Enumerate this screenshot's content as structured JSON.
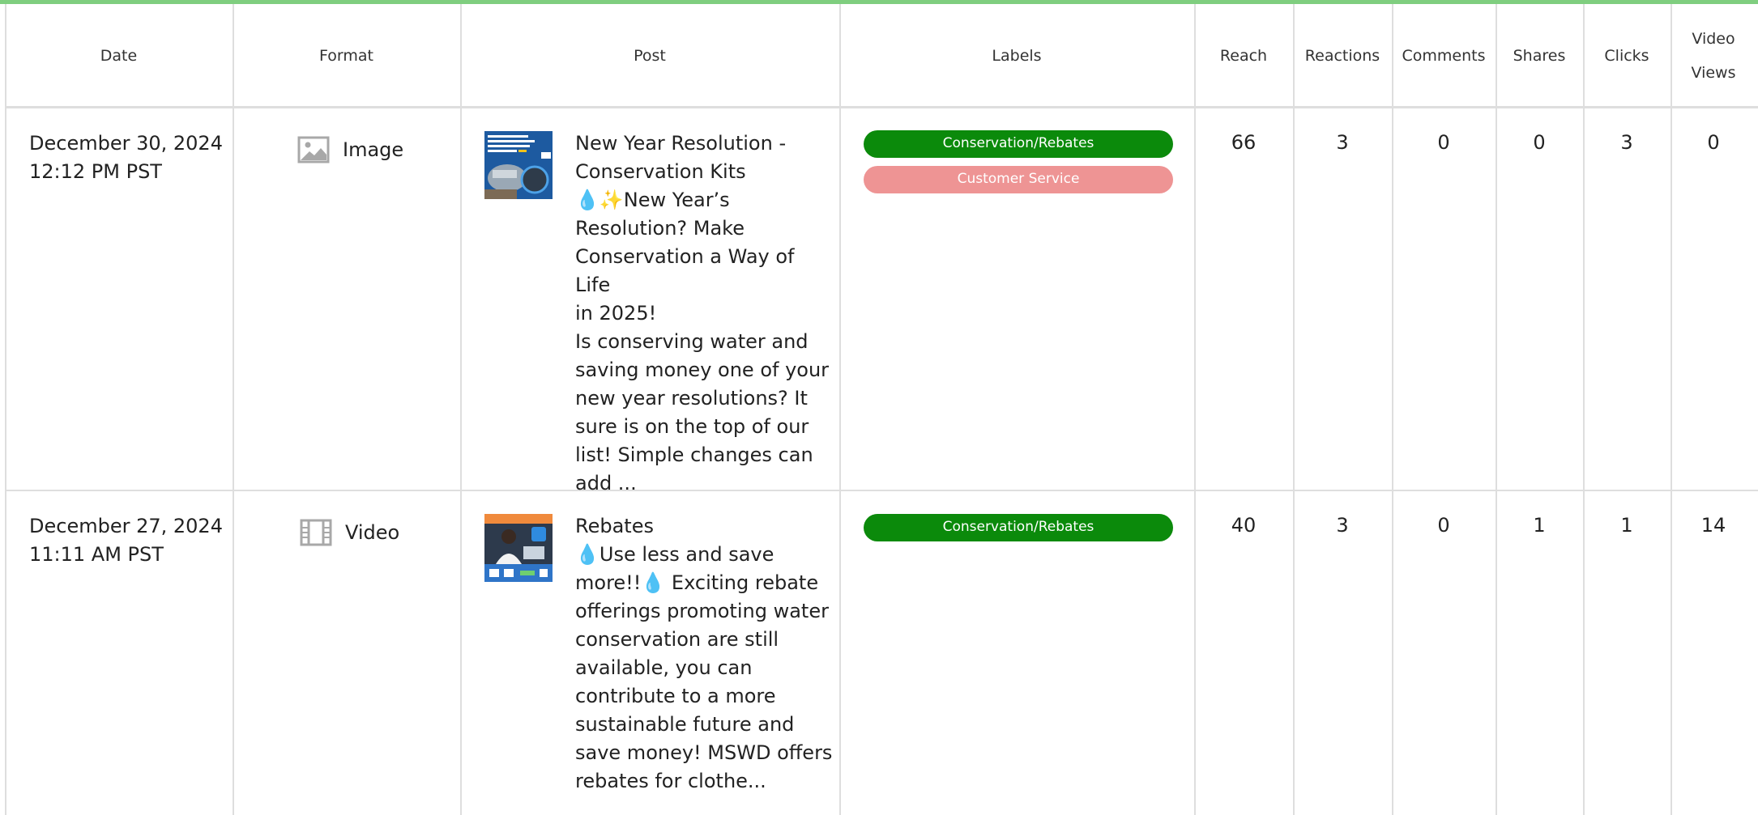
{
  "table": {
    "headers": {
      "date": "Date",
      "format": "Format",
      "post": "Post",
      "labels": "Labels",
      "reach": "Reach",
      "reactions": "Reactions",
      "comments": "Comments",
      "shares": "Shares",
      "clicks": "Clicks",
      "video_views": "Video Views"
    },
    "rows": [
      {
        "date": "December 30, 2024",
        "time": "12:12 PM PST",
        "format_label": "Image",
        "format_icon": "image-icon",
        "post_lines": [
          "New Year Resolution -",
          "Conservation Kits",
          "💧✨New Year’s",
          "Resolution? Make",
          "Conservation a Way of Life",
          "in 2025!",
          "Is conserving water and",
          "saving money one of your",
          "new year resolutions? It",
          "sure is on the top of our",
          "list! Simple changes can",
          "add ..."
        ],
        "labels": [
          {
            "text": "Conservation/Rebates",
            "color": "#0b8a0b"
          },
          {
            "text": "Customer Service",
            "color": "#ee9494"
          }
        ],
        "reach": "66",
        "reactions": "3",
        "comments": "0",
        "shares": "0",
        "clicks": "3",
        "video_views": "0"
      },
      {
        "date": "December 27, 2024",
        "time": "11:11 AM PST",
        "format_label": "Video",
        "format_icon": "film-icon",
        "post_lines": [
          "Rebates",
          "💧Use less and save",
          "more!!💧 Exciting rebate",
          "offerings promoting water",
          "conservation are still",
          "available, you can",
          "contribute to a more",
          "sustainable future and",
          "save money! MSWD offers",
          "rebates for clothe..."
        ],
        "labels": [
          {
            "text": "Conservation/Rebates",
            "color": "#0b8a0b"
          }
        ],
        "reach": "40",
        "reactions": "3",
        "comments": "0",
        "shares": "1",
        "clicks": "1",
        "video_views": "14"
      }
    ]
  },
  "colors": {
    "accent_bar": "#7fce7f",
    "grid": "#dedede",
    "label_green": "#0b8a0b",
    "label_pink": "#ee9494"
  }
}
